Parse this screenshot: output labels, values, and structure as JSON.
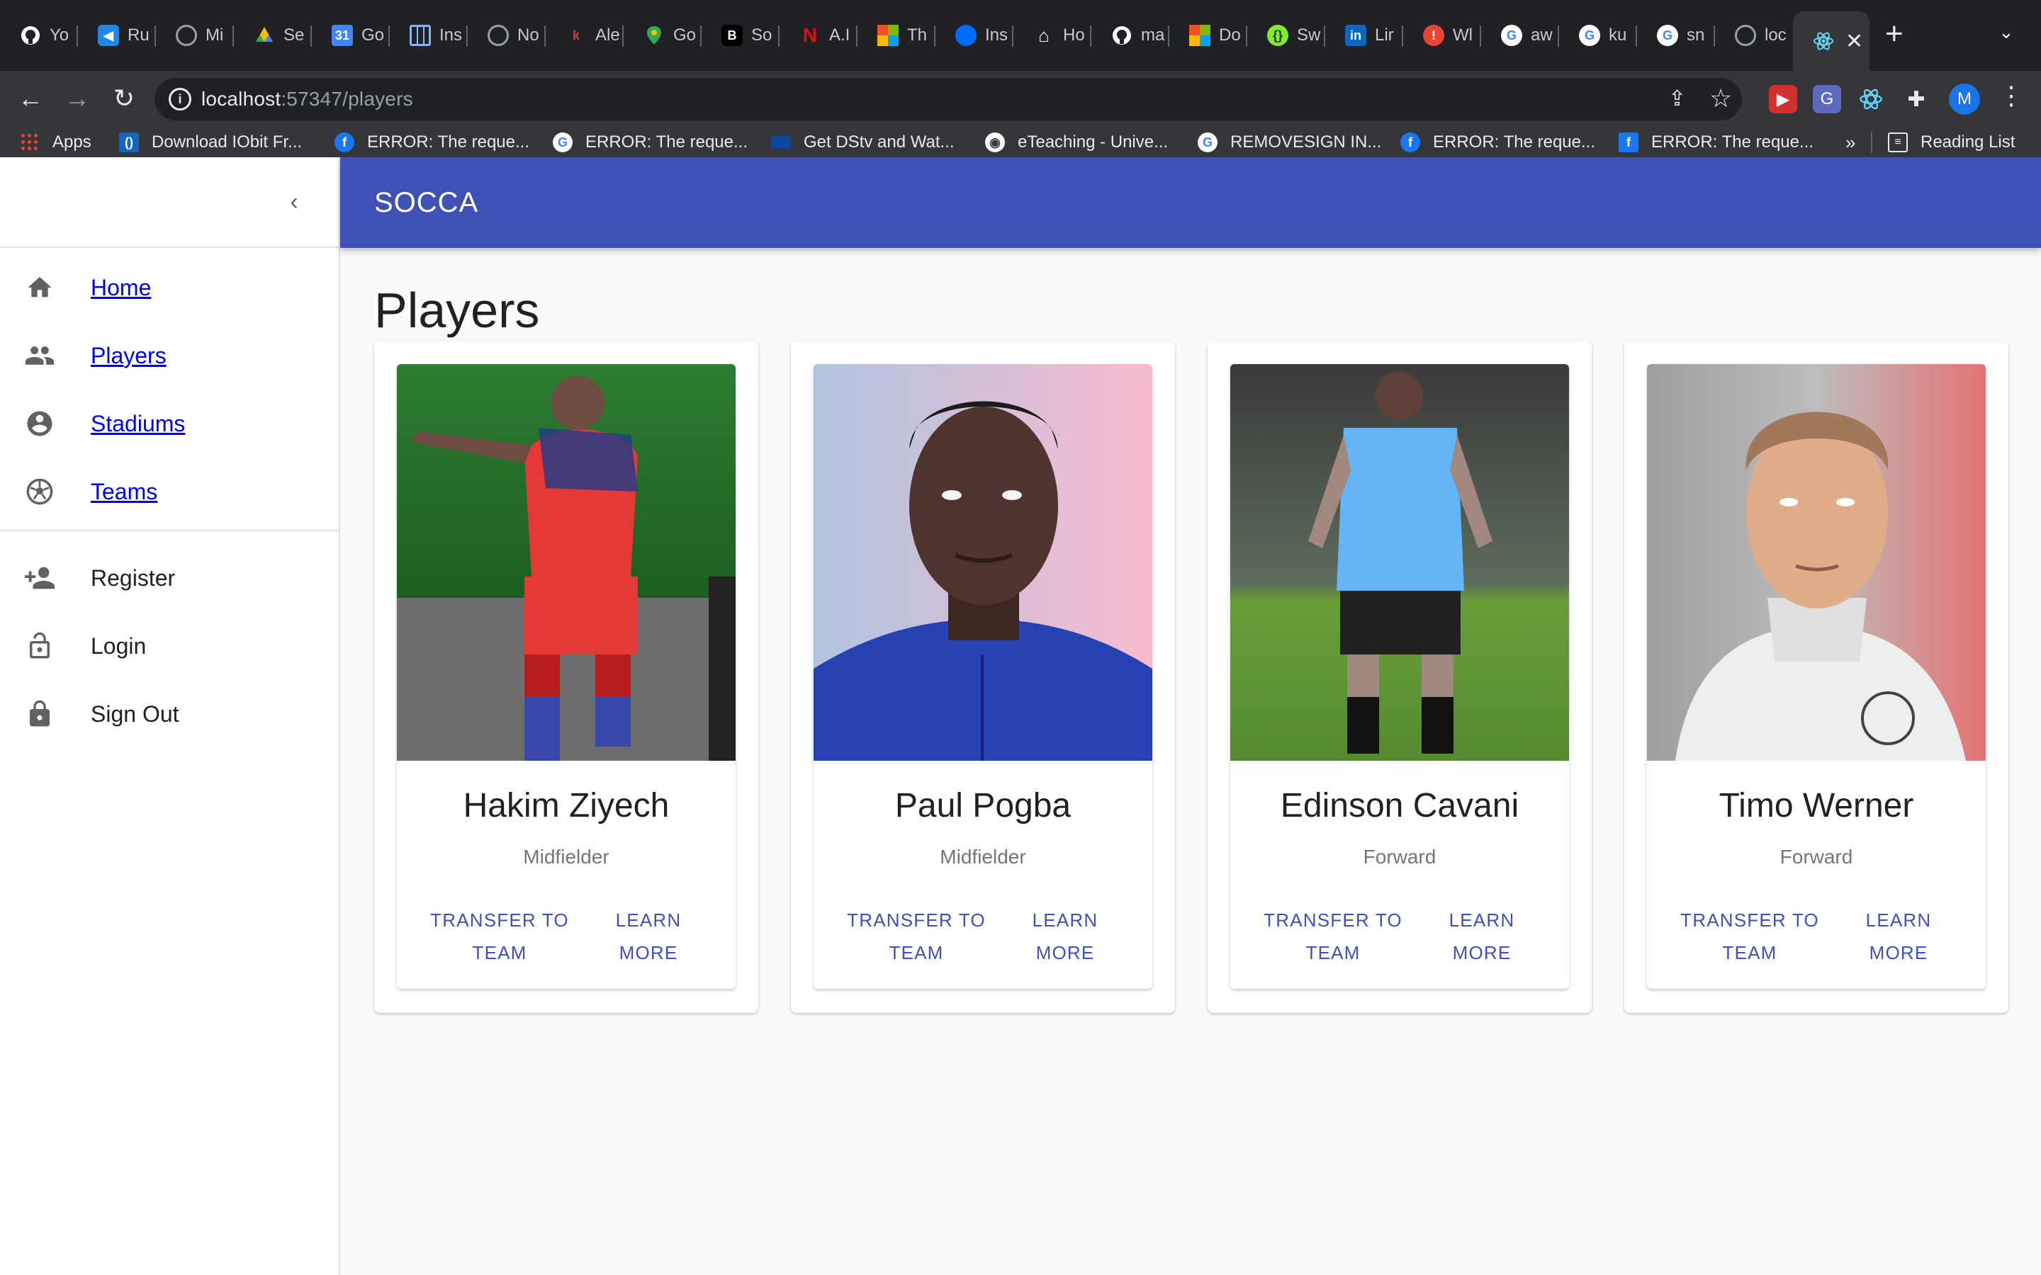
{
  "browser": {
    "tabs": [
      {
        "label": "Yo",
        "fav": "github-icon",
        "color": "#ffffff"
      },
      {
        "label": "Ru",
        "fav": "vscode-icon",
        "color": "#1e88e5"
      },
      {
        "label": "Mi",
        "fav": "globe-icon",
        "color": "#9aa0a6"
      },
      {
        "label": "Se",
        "fav": "drive-icon",
        "color": "#fbbc04"
      },
      {
        "label": "Go",
        "fav": "calendar-icon",
        "color": "#4285f4"
      },
      {
        "label": "Ins",
        "fav": "grid-icon",
        "color": "#8ab4f8"
      },
      {
        "label": "No",
        "fav": "globe-icon",
        "color": "#9aa0a6"
      },
      {
        "label": "Ale",
        "fav": "k-icon",
        "color": "#e53935"
      },
      {
        "label": "Go",
        "fav": "maps-icon",
        "color": "#34a853"
      },
      {
        "label": "So",
        "fav": "b-icon",
        "color": "#000000"
      },
      {
        "label": "A.I",
        "fav": "netflix-icon",
        "color": "#e50914"
      },
      {
        "label": "Th",
        "fav": "microsoft-icon",
        "color": "#f25022"
      },
      {
        "label": "Ins",
        "fav": "digitalocean-icon",
        "color": "#0069ff"
      },
      {
        "label": "Ho",
        "fav": "home-icon",
        "color": "#ffffff"
      },
      {
        "label": "ma",
        "fav": "github-icon",
        "color": "#ffffff"
      },
      {
        "label": "Do",
        "fav": "microsoft-icon",
        "color": "#f25022"
      },
      {
        "label": "Sw",
        "fav": "swagger-icon",
        "color": "#85ea2d"
      },
      {
        "label": "Lir",
        "fav": "linkedin-icon",
        "color": "#0a66c2"
      },
      {
        "label": "Wl",
        "fav": "alert-icon",
        "color": "#ea4335"
      },
      {
        "label": "aw",
        "fav": "google-icon",
        "color": "#ffffff"
      },
      {
        "label": "ku",
        "fav": "google-icon",
        "color": "#ffffff"
      },
      {
        "label": "sn",
        "fav": "google-icon",
        "color": "#ffffff"
      },
      {
        "label": "loc",
        "fav": "globe-icon",
        "color": "#9aa0a6"
      }
    ],
    "url_host": "localhost",
    "url_rest": ":57347/players",
    "profile_initial": "M",
    "bookmarks": [
      {
        "label": "Apps",
        "fav": "apps-grid-icon",
        "color": "#ea4335"
      },
      {
        "label": "Download IObit Fr...",
        "fav": "iobit-icon",
        "color": "#1565c0"
      },
      {
        "label": "ERROR: The reque...",
        "fav": "facebook-icon",
        "color": "#1877f2"
      },
      {
        "label": "ERROR: The reque...",
        "fav": "google-icon",
        "color": "#ffffff"
      },
      {
        "label": "Get DStv and Wat...",
        "fav": "dstv-icon",
        "color": "#0d47a1"
      },
      {
        "label": "eTeaching - Unive...",
        "fav": "globe-icon",
        "color": "#ffffff"
      },
      {
        "label": "REMOVESIGN IN...",
        "fav": "google-icon",
        "color": "#ffffff"
      },
      {
        "label": "ERROR: The reque...",
        "fav": "facebook-icon",
        "color": "#1877f2"
      },
      {
        "label": "ERROR: The reque...",
        "fav": "facebook-icon",
        "color": "#1877f2"
      }
    ],
    "more_bookmarks": "»",
    "reading_list": "Reading List"
  },
  "app": {
    "title": "SOCCA",
    "nav_primary": [
      {
        "label": "Home",
        "icon": "home-icon"
      },
      {
        "label": "Players",
        "icon": "people-icon"
      },
      {
        "label": "Stadiums",
        "icon": "account-circle-icon"
      },
      {
        "label": "Teams",
        "icon": "soccer-ball-icon"
      }
    ],
    "nav_secondary": [
      {
        "label": "Register",
        "icon": "person-add-icon"
      },
      {
        "label": "Login",
        "icon": "lock-open-icon"
      },
      {
        "label": "Sign Out",
        "icon": "lock-icon"
      }
    ],
    "page_title": "Players",
    "players": [
      {
        "name": "Hakim Ziyech",
        "position": "Midfielder",
        "transfer_label": "Transfer to Team",
        "learn_label": "Learn More"
      },
      {
        "name": "Paul Pogba",
        "position": "Midfielder",
        "transfer_label": "Transfer to Team",
        "learn_label": "Learn More"
      },
      {
        "name": "Edinson Cavani",
        "position": "Forward",
        "transfer_label": "Transfer to Team",
        "learn_label": "Learn More"
      },
      {
        "name": "Timo Werner",
        "position": "Forward",
        "transfer_label": "Transfer to Team",
        "learn_label": "Learn More"
      }
    ],
    "colors": {
      "primary": "#3f51b5",
      "link": "#0000ee"
    }
  }
}
